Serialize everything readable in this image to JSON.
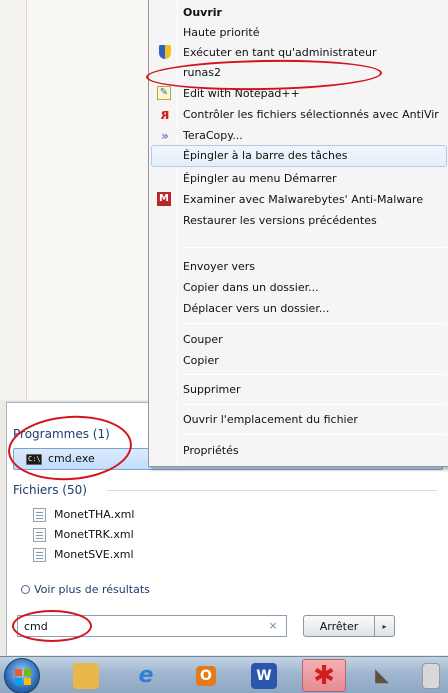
{
  "context_menu": {
    "items": [
      {
        "label": "Ouvrir",
        "bold": true,
        "icon": ""
      },
      {
        "label": "Haute priorité",
        "icon": ""
      },
      {
        "label": "Exécuter en tant qu'administrateur",
        "icon": "uac-shield-icon"
      },
      {
        "label": "runas2",
        "icon": ""
      },
      {
        "label": "Edit with Notepad++",
        "icon": "notepad-plus-plus-icon"
      },
      {
        "label": "Contrôler les fichiers sélectionnés avec AntiVir",
        "icon": "antivir-icon"
      },
      {
        "label": "TeraCopy...",
        "icon": "teracopy-icon"
      },
      {
        "label": "Épingler à la barre des tâches",
        "icon": "",
        "highlighted": true
      },
      {
        "label": "Épingler au menu Démarrer",
        "icon": ""
      },
      {
        "label": "Examiner avec Malwarebytes' Anti-Malware",
        "icon": "malwarebytes-icon"
      },
      {
        "label": "Restaurer les versions précédentes",
        "icon": ""
      },
      {
        "label": "Envoyer vers",
        "icon": ""
      },
      {
        "label": "Copier dans un dossier...",
        "icon": ""
      },
      {
        "label": "Déplacer vers un dossier...",
        "icon": ""
      },
      {
        "label": "Couper",
        "icon": ""
      },
      {
        "label": "Copier",
        "icon": ""
      },
      {
        "label": "Supprimer",
        "icon": ""
      },
      {
        "label": "Ouvrir l'emplacement du fichier",
        "icon": ""
      },
      {
        "label": "Propriétés",
        "icon": ""
      }
    ]
  },
  "start_menu": {
    "programs_header": "Programmes (1)",
    "program_result": "cmd.exe",
    "files_header": "Fichiers (50)",
    "files": [
      "MonetTHA.xml",
      "MonetTRK.xml",
      "MonetSVE.xml"
    ],
    "more_results": "Voir plus de résultats",
    "search_value": "cmd",
    "clear_glyph": "×",
    "shutdown_label": "Arrêter",
    "shutdown_arrow": "▸"
  },
  "taskbar": {
    "apps": [
      {
        "name": "start-orb"
      },
      {
        "name": "windows-explorer-icon",
        "color": "#e9b84a"
      },
      {
        "name": "internet-explorer-icon",
        "color": "#2f7fd8",
        "glyph": "e"
      },
      {
        "name": "outlook-icon",
        "color": "#e57a1c",
        "glyph": "O"
      },
      {
        "name": "word-icon",
        "color": "#2a56b0",
        "glyph": "W"
      },
      {
        "name": "red-splat-app-icon",
        "color": "#d11f1f",
        "active": true
      },
      {
        "name": "gimp-icon",
        "color": "#7a6a55"
      },
      {
        "name": "notepad-icon",
        "color": "#c8c8c8"
      }
    ]
  },
  "colors": {
    "annotation": "#d4131b",
    "menu_highlight": "#aecbf0",
    "selected_result": "#c1dcfc"
  }
}
